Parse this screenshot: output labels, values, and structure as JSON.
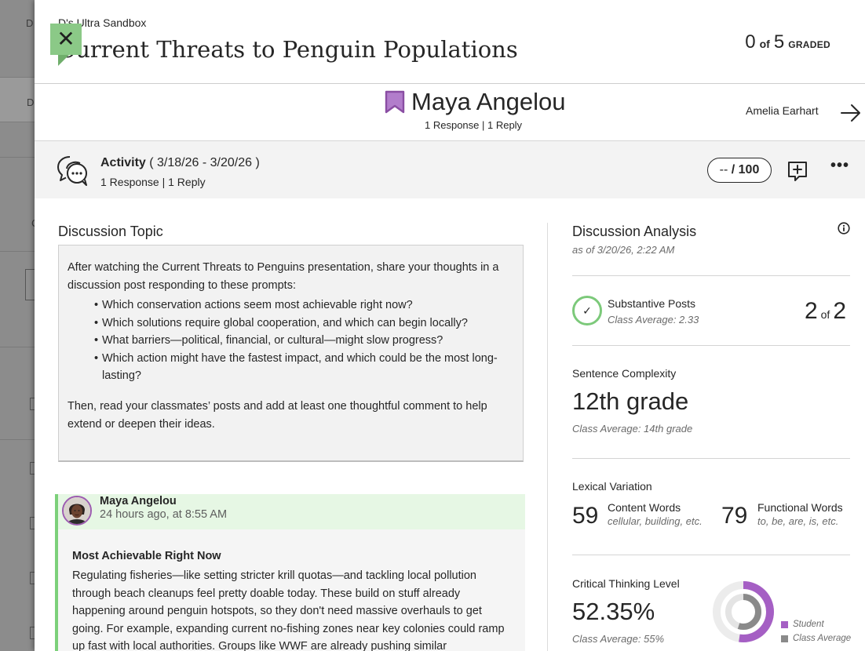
{
  "background": {
    "fragments": [
      "D",
      "D",
      "C"
    ]
  },
  "header": {
    "course": "D's Ultra Sandbox",
    "title": "Current Threats to Penguin Populations",
    "graded_count": "0",
    "graded_of": "of",
    "graded_total": "5",
    "graded_label": "GRADED",
    "close_glyph": "✕"
  },
  "student": {
    "name": "Maya Angelou",
    "counts": "1 Response | 1 Reply",
    "next_student": "Amelia Earhart"
  },
  "activity": {
    "label": "Activity",
    "dates": "( 3/18/26 - 3/20/26 )",
    "counts": "1 Response | 1 Reply",
    "grade_placeholder": "--",
    "grade_max": "/ 100",
    "more_glyph": "•••"
  },
  "topic": {
    "heading": "Discussion Topic",
    "intro": "After watching the Current Threats to Penguins presentation, share your thoughts in a discussion post responding to these prompts:",
    "bullets": [
      "Which conservation actions seem most achievable right now?",
      "Which solutions require global cooperation, and which can begin locally?",
      "What barriers—political, financial, or cultural—might slow progress?",
      "Which action might have the fastest impact, and which could be the most long-lasting?"
    ],
    "closing": "Then, read your classmates’ posts and add at least one thoughtful comment to help extend or deepen their ideas."
  },
  "post": {
    "author": "Maya Angelou",
    "time": "24 hours ago, at 8:55 AM",
    "title": "Most Achievable Right Now",
    "body": "Regulating fisheries—like setting stricter krill quotas—and tackling local pollution through beach cleanups feel pretty doable today. These build on stuff already happening around penguin hotspots, so they don't need massive overhauls to get going. For example, expanding current no-fishing zones near key colonies could ramp up fast with local authorities. Groups like WWF are already pushing similar"
  },
  "analysis": {
    "title": "Discussion Analysis",
    "as_of": "as of 3/20/26, 2:22 AM",
    "substantive": {
      "label": "Substantive Posts",
      "class_avg": "Class Average: 2.33",
      "score": "2",
      "of": "of",
      "total": "2",
      "check_glyph": "✓"
    },
    "sentence_complexity": {
      "label": "Sentence Complexity",
      "value": "12th grade",
      "class_avg": "Class Average: 14th grade"
    },
    "lexical": {
      "label": "Lexical Variation",
      "content_count": "59",
      "content_label": "Content Words",
      "content_examples": "cellular, building, etc.",
      "functional_count": "79",
      "functional_label": "Functional Words",
      "functional_examples": "to, be, are, is, etc."
    },
    "critical_thinking": {
      "label": "Critical Thinking Level",
      "value": "52.35%",
      "class_avg": "Class Average: 55%",
      "student_fraction": 0.5235,
      "class_fraction": 0.55,
      "legend_student": "Student",
      "legend_class": "Class Average",
      "student_color": "#a55fc4",
      "class_color": "#8a8a8a"
    }
  },
  "colors": {
    "accent_green": "#8bc987",
    "post_bar": "#7cd07a",
    "bookmark_purple": "#9c5cb0"
  }
}
